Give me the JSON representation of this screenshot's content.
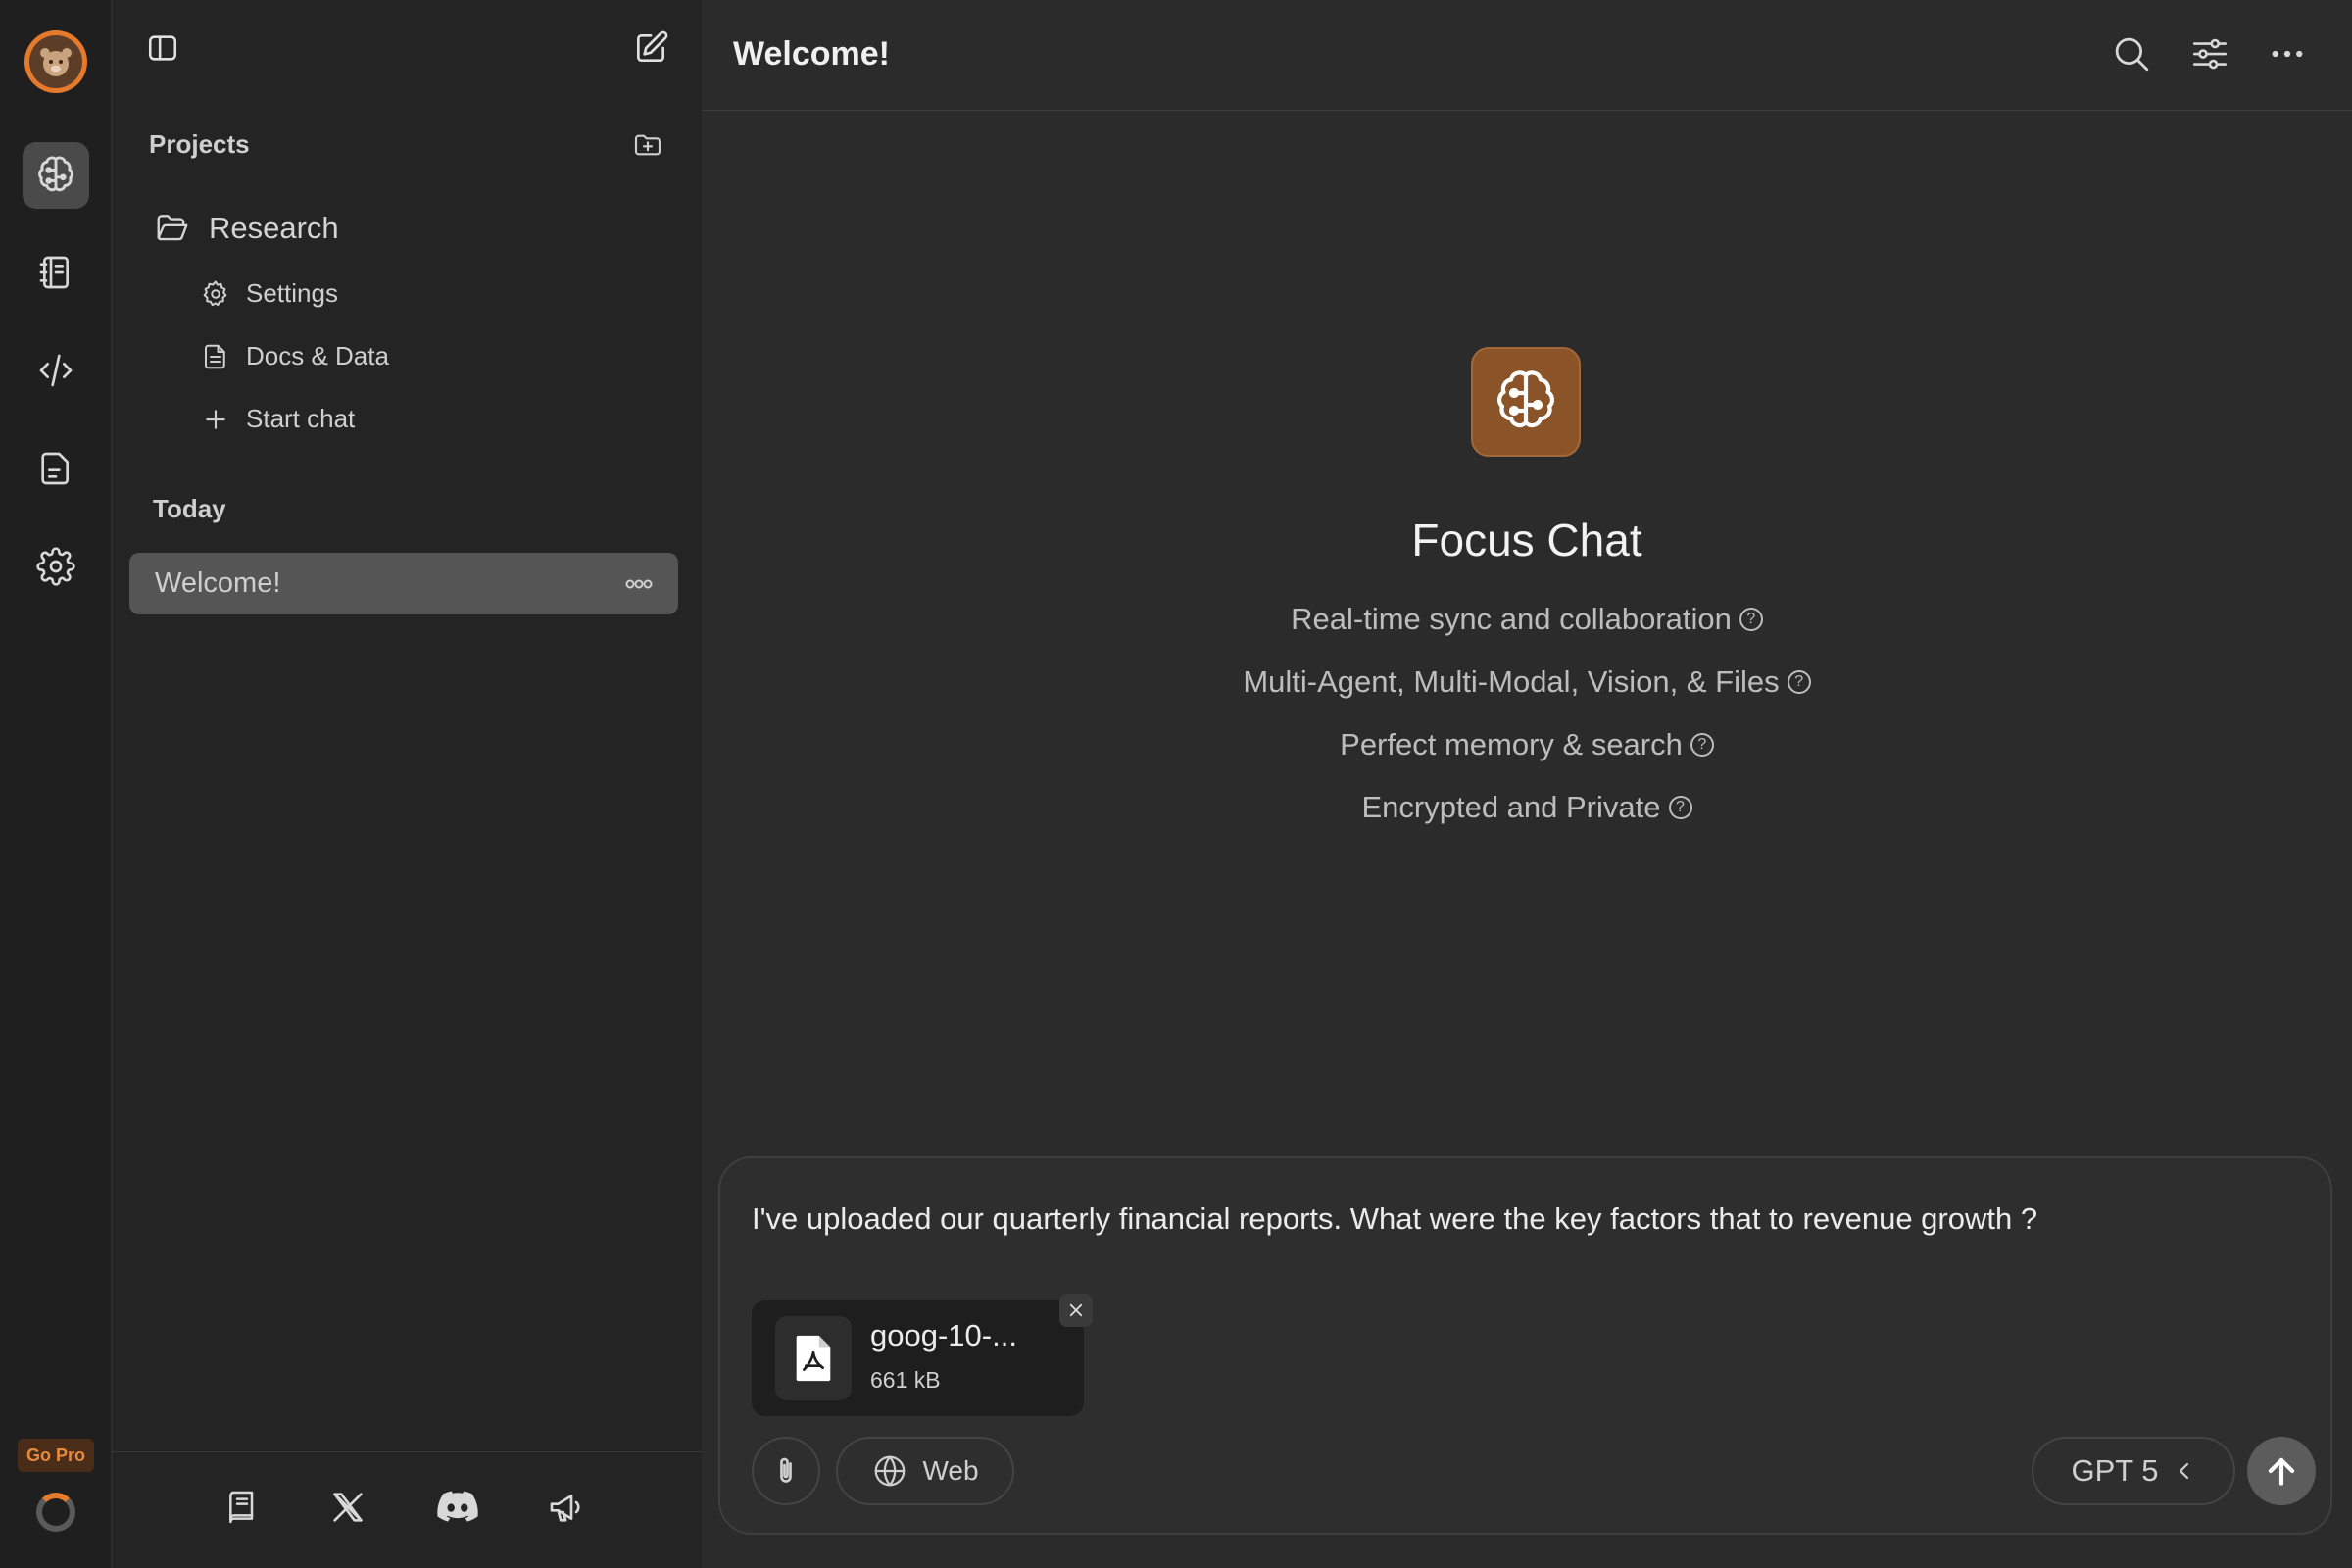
{
  "colors": {
    "accent": "#e57a2c",
    "brand_logo_bg": "#8a5428",
    "rail_bg": "#1f1f1f",
    "sidebar_bg": "#242424",
    "main_bg": "#2b2b2b",
    "selected_chat_bg": "#555555"
  },
  "rail": {
    "items": [
      {
        "name": "brain-icon",
        "active": true
      },
      {
        "name": "notebook-icon",
        "active": false
      },
      {
        "name": "code-pen-icon",
        "active": false
      },
      {
        "name": "document-icon",
        "active": false
      },
      {
        "name": "gear-icon",
        "active": false
      }
    ],
    "go_pro_label": "Go Pro"
  },
  "sidebar": {
    "projects_label": "Projects",
    "project": {
      "name": "Research",
      "children": [
        "Settings",
        "Docs & Data",
        "Start chat"
      ]
    },
    "today_label": "Today",
    "chats": [
      {
        "title": "Welcome!",
        "selected": true
      }
    ],
    "footer_icons": [
      "book-icon",
      "x-logo-icon",
      "discord-icon",
      "megaphone-icon"
    ]
  },
  "header": {
    "title": "Welcome!",
    "icons": [
      "search-icon",
      "sliders-icon",
      "more-horizontal-icon"
    ]
  },
  "hero": {
    "title": "Focus Chat",
    "features": [
      "Real-time sync and collaboration",
      "Multi-Agent, Multi-Modal, Vision, & Files",
      "Perfect memory & search",
      "Encrypted and Private"
    ],
    "help_glyph": "?"
  },
  "composer": {
    "text": "I've uploaded our quarterly financial reports. What were the key factors that to revenue growth ?",
    "attachment": {
      "name": "goog-10-...",
      "size": "661 kB"
    },
    "web_label": "Web",
    "model_label": "GPT 5"
  }
}
